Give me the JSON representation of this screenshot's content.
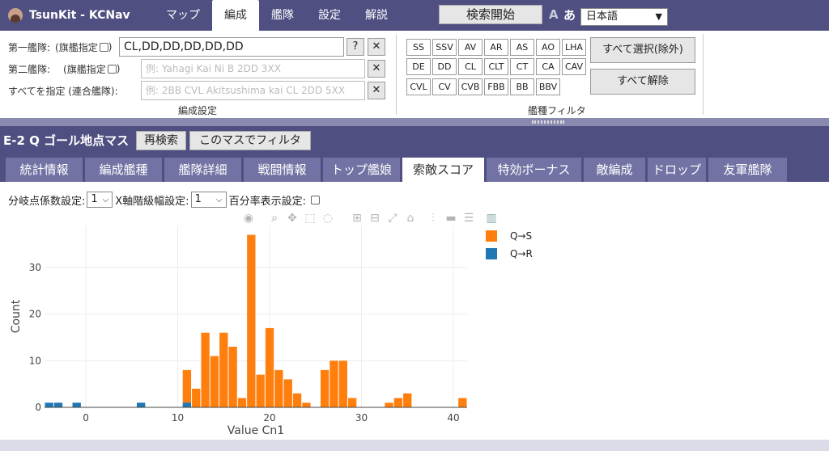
{
  "app": {
    "title": "TsunKit - KCNav"
  },
  "nav": {
    "items": [
      {
        "label": "マップ"
      },
      {
        "label": "編成"
      },
      {
        "label": "艦隊"
      },
      {
        "label": "設定"
      },
      {
        "label": "解説"
      }
    ],
    "active": "編成",
    "search_label": "検索開始",
    "font_a": "A",
    "font_kana": "あ",
    "language": "日本語"
  },
  "fleet": {
    "first_label": "第一艦隊:",
    "first_flagship": "(旗艦指定",
    "first_value": "CL,DD,DD,DD,DD,DD",
    "second_label": "第二艦隊:",
    "second_flagship": "(旗艦指定",
    "second_placeholder": "例: Yahagi Kai Ni B 2DD 3XX",
    "combined_label": "すべてを指定 (連合艦隊):",
    "combined_placeholder": "例: 2BB CVL Akitsushima kai CL 2DD 5XX",
    "help": "?",
    "clear": "✕",
    "caption": "編成設定"
  },
  "ship_filter": {
    "rows": [
      [
        "SS",
        "SSV",
        "AV",
        "AR",
        "AS",
        "AO",
        "LHA"
      ],
      [
        "DE",
        "DD",
        "CL",
        "CLT",
        "CT",
        "CA",
        "CAV"
      ],
      [
        "CVL",
        "CV",
        "CVB",
        "FBB",
        "BB",
        "BBV"
      ]
    ],
    "select_all": "すべて選択(除外)",
    "clear_all": "すべて解除",
    "caption": "艦種フィルタ"
  },
  "result": {
    "node_title": "E-2 Q ゴール地点マス",
    "re_search": "再検索",
    "filter_here": "このマスでフィルタ",
    "tabs": [
      "統計情報",
      "編成艦種",
      "艦隊詳細",
      "戦闘情報",
      "トップ艦娘",
      "索敵スコア",
      "特効ボーナス",
      "敵編成",
      "ドロップ",
      "友軍艦隊"
    ],
    "active_tab": "索敵スコア"
  },
  "options": {
    "branch_coef_label": "分岐点係数設定:",
    "branch_coef_value": "1",
    "bin_width_label": "X軸階級幅設定:",
    "bin_width_value": "1",
    "percent_label": "百分率表示設定:"
  },
  "chart_data": {
    "type": "bar",
    "xlabel": "Value Cn1",
    "ylabel": "Count",
    "xlim": [
      -4.5,
      41.5
    ],
    "ylim": [
      0,
      39
    ],
    "x_ticks": [
      0,
      10,
      20,
      30,
      40
    ],
    "y_ticks": [
      0,
      10,
      20,
      30
    ],
    "grid": true,
    "legend_position": "top-right",
    "series": [
      {
        "name": "Q→S",
        "color": "#ff7f0e",
        "x": [
          11,
          12,
          13,
          14,
          15,
          16,
          17,
          18,
          19,
          20,
          21,
          22,
          23,
          24,
          26,
          27,
          28,
          29,
          33,
          34,
          35,
          41
        ],
        "values": [
          8,
          4,
          16,
          11,
          16,
          13,
          2,
          37,
          7,
          17,
          8,
          6,
          3,
          1,
          8,
          10,
          10,
          2,
          1,
          2,
          3,
          2
        ]
      },
      {
        "name": "Q→R",
        "color": "#1f77b4",
        "x": [
          -4,
          -3,
          -1,
          6,
          11
        ],
        "values": [
          1,
          1,
          1,
          1,
          1
        ]
      }
    ]
  }
}
